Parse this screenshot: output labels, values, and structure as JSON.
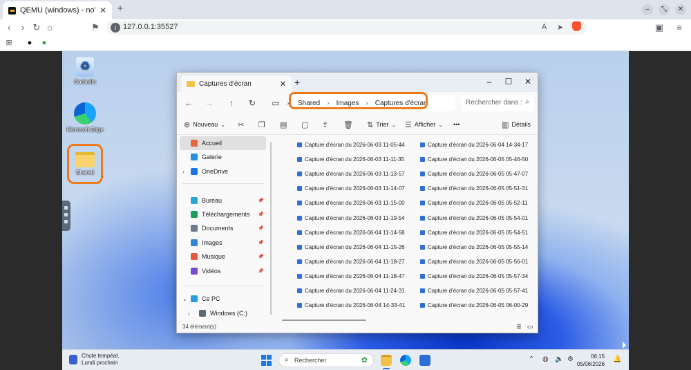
{
  "browser": {
    "tab_title": "QEMU (windows) - noVNC",
    "url": "127.0.0.1:35527"
  },
  "desktop": {
    "icons": [
      {
        "label": "Corbeille"
      },
      {
        "label": "Microsoft Edge"
      },
      {
        "label": "Shared"
      }
    ]
  },
  "explorer": {
    "tab_title": "Captures d'écran",
    "breadcrumb": [
      "Shared",
      "Images",
      "Captures d'écran"
    ],
    "search_placeholder": "Rechercher dans :",
    "commands": {
      "new": "Nouveau",
      "sort": "Trier",
      "view": "Afficher",
      "more": "•••",
      "details": "Détails"
    },
    "sidebar": [
      {
        "label": "Accueil",
        "color": "#e8663a"
      },
      {
        "label": "Galerie",
        "color": "#2a8de0"
      },
      {
        "label": "OneDrive",
        "color": "#1b74e4"
      },
      {
        "label": "Bureau",
        "color": "#27a7d8"
      },
      {
        "label": "Téléchargements",
        "color": "#18a05c"
      },
      {
        "label": "Documents",
        "color": "#6c7a8a"
      },
      {
        "label": "Images",
        "color": "#2f86d8"
      },
      {
        "label": "Musique",
        "color": "#e8573a"
      },
      {
        "label": "Vidéos",
        "color": "#7a4bd6"
      },
      {
        "label": "Ce PC",
        "color": "#2a9de0"
      },
      {
        "label": "Windows (C:)",
        "color": "#5a6a7a"
      }
    ],
    "files_col1": [
      "Capture d'écran du 2026-06-03 11-05-44",
      "Capture d'écran du 2026-06-03 11-11-35",
      "Capture d'écran du 2026-06-03 11-13-57",
      "Capture d'écran du 2026-06-03 11-14-07",
      "Capture d'écran du 2026-06-03 11-15-00",
      "Capture d'écran du 2026-06-03 11-19-54",
      "Capture d'écran du 2026-06-04 11-14-58",
      "Capture d'écran du 2026-06-04 11-15-26",
      "Capture d'écran du 2026-06-04 11-18-27",
      "Capture d'écran du 2026-06-04 11-18-47",
      "Capture d'écran du 2026-06-04 11-24-31",
      "Capture d'écran du 2026-06-04 14-33-41"
    ],
    "files_col2": [
      "Capture d'écran du 2026-06-04 14-34-17",
      "Capture d'écran du 2026-06-05 05-46-50",
      "Capture d'écran du 2026-06-05 05-47-07",
      "Capture d'écran du 2026-06-05 05-51-31",
      "Capture d'écran du 2026-06-05 05-52-11",
      "Capture d'écran du 2026-06-05 05-54-01",
      "Capture d'écran du 2026-06-05 05-54-51",
      "Capture d'écran du 2026-06-05 05-55-14",
      "Capture d'écran du 2026-06-05 05-56-01",
      "Capture d'écran du 2026-06-05 05-57-34",
      "Capture d'écran du 2026-06-05 05-57-41",
      "Capture d'écran du 2026-06-05 06-00-29"
    ],
    "status": "34 élément(s)"
  },
  "taskbar": {
    "weather_line1": "Chute tempéat.",
    "weather_line2": "Lundi prochain",
    "search": "Rechercher",
    "time": "06:15",
    "date": "05/06/2026"
  },
  "colors": {
    "highlight": "#f07a1a",
    "accent": "#1f7ae0"
  }
}
